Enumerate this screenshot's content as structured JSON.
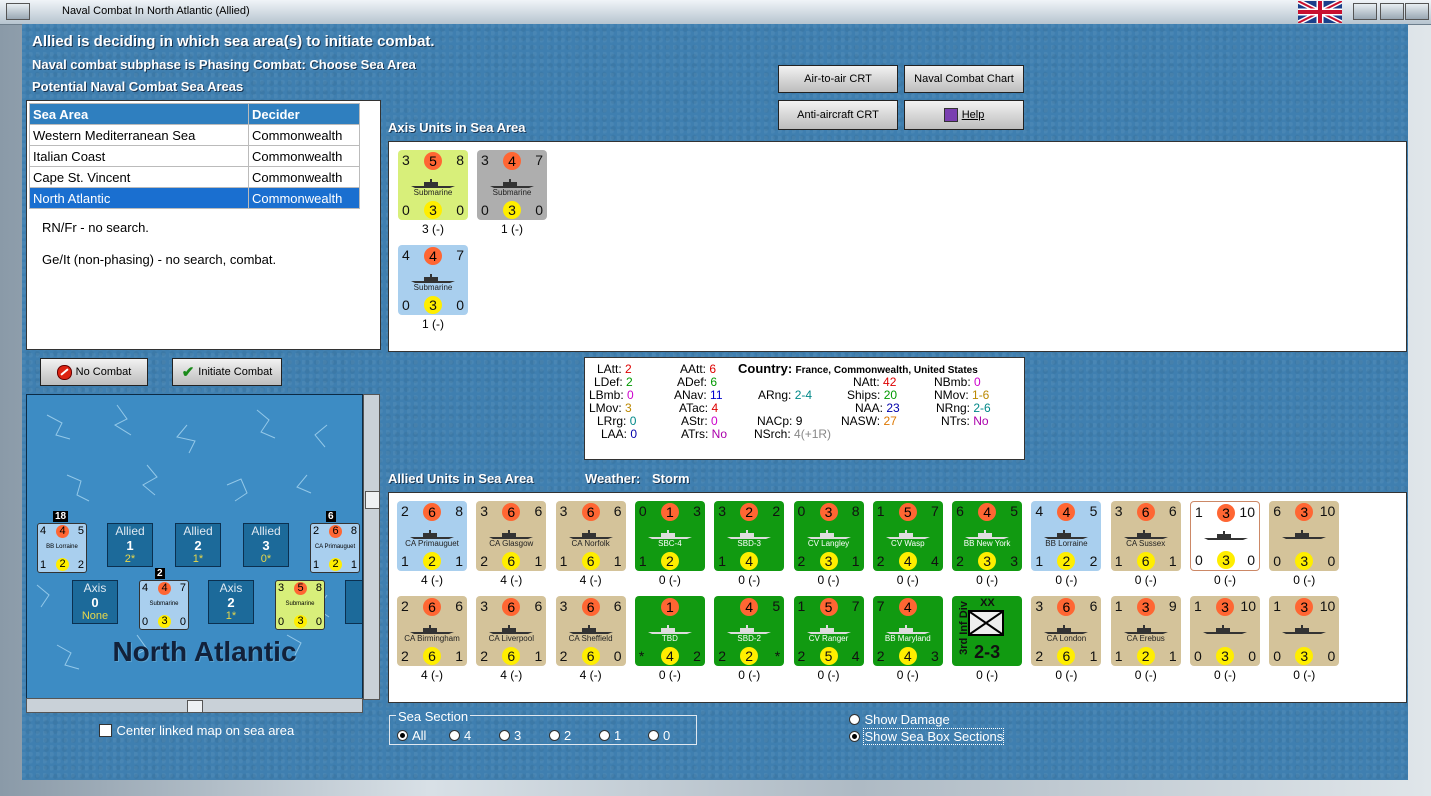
{
  "window": {
    "title": "Naval Combat In North Atlantic (Allied)"
  },
  "header": {
    "line1": "Allied is deciding in which sea area(s) to initiate combat.",
    "line2": "Naval combat subphase is Phasing Combat: Choose Sea Area",
    "line3": "Potential Naval Combat Sea Areas"
  },
  "buttons": {
    "air_to_air": "Air-to-air CRT",
    "naval_chart": "Naval Combat Chart",
    "anti_aircraft": "Anti-aircraft CRT",
    "help": "Help",
    "no_combat": "No Combat",
    "initiate_combat": "Initiate Combat"
  },
  "sea_table": {
    "headers": [
      "Sea Area",
      "Decider"
    ],
    "rows": [
      {
        "area": "Western Mediterranean Sea",
        "decider": "Commonwealth"
      },
      {
        "area": "Italian Coast",
        "decider": "Commonwealth"
      },
      {
        "area": "Cape St. Vincent",
        "decider": "Commonwealth"
      },
      {
        "area": "North Atlantic",
        "decider": "Commonwealth"
      }
    ],
    "note1": "RN/Fr - no search.",
    "note2": "Ge/It (non-phasing) - no search, combat."
  },
  "axis_section": {
    "title": "Axis Units in Sea Area",
    "units": [
      {
        "tl": "3",
        "tc": "5",
        "tr": "8",
        "name": "Submarine",
        "bl": "0",
        "bc": "3",
        "br": "0",
        "count": "3 (-)",
        "color": "#d8ef7a"
      },
      {
        "tl": "3",
        "tc": "4",
        "tr": "7",
        "name": "Submarine",
        "bl": "0",
        "bc": "3",
        "br": "0",
        "count": "1 (-)",
        "color": "#aeaeae"
      },
      {
        "tl": "4",
        "tc": "4",
        "tr": "7",
        "name": "Submarine",
        "bl": "0",
        "bc": "3",
        "br": "0",
        "count": "1 (-)",
        "color": "#a9cfee"
      }
    ]
  },
  "stats": {
    "latt_l": "LAtt:",
    "latt": "2",
    "ldef_l": "LDef:",
    "ldef": "2",
    "lbmb_l": "LBmb:",
    "lbmb": "0",
    "lmov_l": "LMov:",
    "lmov": "3",
    "lrrg_l": "LRrg:",
    "lrrg": "0",
    "laa_l": "LAA:",
    "laa": "0",
    "aatt_l": "AAtt:",
    "aatt": "6",
    "adef_l": "ADef:",
    "adef": "6",
    "anav_l": "ANav:",
    "anav": "11",
    "atac_l": "ATac:",
    "atac": "4",
    "astr_l": "AStr:",
    "astr": "0",
    "atrs_l": "ATrs:",
    "atrs": "No",
    "country_l": "Country:",
    "country": "France, Commonwealth, United States",
    "arng_l": "ARng:",
    "arng": "2-4",
    "nacp_l": "NACp:",
    "nacp": "9",
    "nsrch_l": "NSrch:",
    "nsrch": "4(+1R)",
    "natt_l": "NAtt:",
    "natt": "42",
    "ships_l": "Ships:",
    "ships": "20",
    "naa_l": "NAA:",
    "naa": "23",
    "nasw_l": "NASW:",
    "nasw": "27",
    "nbmb_l": "NBmb:",
    "nbmb": "0",
    "nmov_l": "NMov:",
    "nmov": "1-6",
    "nrng_l": "NRng:",
    "nrng": "2-6",
    "ntrs_l": "NTrs:",
    "ntrs": "No"
  },
  "allied_section": {
    "title": "Allied Units in Sea Area",
    "weather_label": "Weather:",
    "weather": "Storm",
    "row1": [
      {
        "tl": "2",
        "tc": "6",
        "tr": "8",
        "name": "CA Primauguet",
        "bl": "1",
        "bc": "2",
        "br": "1",
        "count": "4 (-)",
        "color": "#a9cfee"
      },
      {
        "tl": "3",
        "tc": "6",
        "tr": "6",
        "name": "CA Glasgow",
        "bl": "2",
        "bc": "6",
        "br": "1",
        "count": "4 (-)",
        "color": "#d4c39a"
      },
      {
        "tl": "3",
        "tc": "6",
        "tr": "6",
        "name": "CA Norfolk",
        "bl": "1",
        "bc": "6",
        "br": "1",
        "count": "4 (-)",
        "color": "#d4c39a"
      },
      {
        "tl": "0",
        "tc": "1",
        "tr": "3",
        "name": "SBC-4",
        "bl": "1",
        "bc": "2",
        "br": "",
        "count": "0 (-)",
        "color": "#119a11"
      },
      {
        "tl": "3",
        "tc": "2",
        "tr": "2",
        "name": "SBD-3",
        "bl": "1",
        "bc": "4",
        "br": "",
        "count": "0 (-)",
        "color": "#119a11"
      },
      {
        "tl": "0",
        "tc": "3",
        "tr": "8",
        "name": "CV Langley",
        "bl": "2",
        "bc": "3",
        "br": "1",
        "count": "0 (-)",
        "color": "#119a11"
      },
      {
        "tl": "1",
        "tc": "5",
        "tr": "7",
        "name": "CV Wasp",
        "bl": "2",
        "bc": "4",
        "br": "4",
        "count": "0 (-)",
        "color": "#119a11"
      },
      {
        "tl": "6",
        "tc": "4",
        "tr": "5",
        "name": "BB New York",
        "bl": "2",
        "bc": "3",
        "br": "3",
        "count": "0 (-)",
        "color": "#119a11"
      },
      {
        "tl": "4",
        "tc": "4",
        "tr": "5",
        "name": "BB Lorraine",
        "bl": "1",
        "bc": "2",
        "br": "2",
        "count": "0 (-)",
        "color": "#a9cfee"
      },
      {
        "tl": "3",
        "tc": "6",
        "tr": "6",
        "name": "CA Sussex",
        "bl": "1",
        "bc": "6",
        "br": "1",
        "count": "0 (-)",
        "color": "#d4c39a"
      },
      {
        "tl": "1",
        "tc": "3",
        "tr": "10",
        "name": "",
        "bl": "0",
        "bc": "3",
        "br": "0",
        "count": "0 (-)",
        "color": "#ffffff"
      },
      {
        "tl": "6",
        "tc": "3",
        "tr": "10",
        "name": "",
        "bl": "0",
        "bc": "3",
        "br": "0",
        "count": "0 (-)",
        "color": "#d4c39a"
      }
    ],
    "row2": [
      {
        "tl": "2",
        "tc": "6",
        "tr": "6",
        "name": "CA Birmingham",
        "bl": "2",
        "bc": "6",
        "br": "1",
        "count": "4 (-)",
        "color": "#d4c39a"
      },
      {
        "tl": "3",
        "tc": "6",
        "tr": "6",
        "name": "CA Liverpool",
        "bl": "2",
        "bc": "6",
        "br": "1",
        "count": "4 (-)",
        "color": "#d4c39a"
      },
      {
        "tl": "3",
        "tc": "6",
        "tr": "6",
        "name": "CA Sheffield",
        "bl": "2",
        "bc": "6",
        "br": "0",
        "count": "4 (-)",
        "color": "#d4c39a"
      },
      {
        "tl": "",
        "tc": "1",
        "tr": "",
        "name": "TBD",
        "bl": "*",
        "bc": "4",
        "br": "2",
        "count": "0 (-)",
        "color": "#119a11"
      },
      {
        "tl": "",
        "tc": "4",
        "tr": "5",
        "name": "SBD-2",
        "bl": "2",
        "bc": "2",
        "br": "*",
        "count": "0 (-)",
        "color": "#119a11"
      },
      {
        "tl": "1",
        "tc": "5",
        "tr": "7",
        "name": "CV Ranger",
        "bl": "2",
        "bc": "5",
        "br": "4",
        "count": "0 (-)",
        "color": "#119a11"
      },
      {
        "tl": "7",
        "tc": "4",
        "tr": "",
        "name": "BB Maryland",
        "bl": "2",
        "bc": "4",
        "br": "3",
        "count": "0 (-)",
        "color": "#119a11"
      },
      {
        "tl": "",
        "tc": "",
        "tr": "",
        "name": "3rd Inf Div",
        "bl": "",
        "bc": "",
        "br": "",
        "count": "0 (-)",
        "color": "#119a11",
        "inf": "2-3",
        "xx": "XX"
      },
      {
        "tl": "3",
        "tc": "6",
        "tr": "6",
        "name": "CA London",
        "bl": "2",
        "bc": "6",
        "br": "1",
        "count": "0 (-)",
        "color": "#d4c39a"
      },
      {
        "tl": "1",
        "tc": "3",
        "tr": "9",
        "name": "CA Erebus",
        "bl": "1",
        "bc": "2",
        "br": "1",
        "count": "0 (-)",
        "color": "#d4c39a"
      },
      {
        "tl": "1",
        "tc": "3",
        "tr": "10",
        "name": "",
        "bl": "0",
        "bc": "3",
        "br": "0",
        "count": "0 (-)",
        "color": "#d4c39a"
      },
      {
        "tl": "1",
        "tc": "3",
        "tr": "10",
        "name": "",
        "bl": "0",
        "bc": "3",
        "br": "0",
        "count": "0 (-)",
        "color": "#d4c39a"
      }
    ]
  },
  "map": {
    "area_name": "North Atlantic",
    "allied_boxes": [
      {
        "label": "Allied",
        "num": "1",
        "val": "2*"
      },
      {
        "label": "Allied",
        "num": "2",
        "val": "1*"
      },
      {
        "label": "Allied",
        "num": "3",
        "val": "0*"
      }
    ],
    "axis_boxes": [
      {
        "label": "Axis",
        "num": "0",
        "val": "None"
      },
      {
        "label": "Axis",
        "num": "2",
        "val": "1*"
      }
    ],
    "axis_partial": "A",
    "stack_left": {
      "count": "18",
      "tl": "4",
      "tc": "4",
      "tr": "5",
      "name": "BB Lorraine",
      "bl": "1",
      "bc": "2",
      "br": "2"
    },
    "stack_right": {
      "count": "6",
      "tl": "2",
      "tc": "6",
      "tr": "8",
      "name": "CA Primauguet",
      "bl": "1",
      "bc": "2",
      "br": "1"
    },
    "stack_axis1": {
      "count": "2",
      "tl": "4",
      "tc": "4",
      "tr": "7",
      "name": "Submarine",
      "bl": "0",
      "bc": "3",
      "br": "0"
    },
    "stack_axis2": {
      "tl": "3",
      "tc": "5",
      "tr": "8",
      "name": "Submarine",
      "bl": "0",
      "bc": "3",
      "br": "0"
    }
  },
  "footer": {
    "center_map": "Center linked map on sea area",
    "sea_section": "Sea Section",
    "options": [
      "All",
      "4",
      "3",
      "2",
      "1",
      "0"
    ],
    "selected_option": "All",
    "show_damage": "Show Damage",
    "show_sections": "Show Sea Box Sections"
  },
  "colors": {
    "panel": "#3f7fb0",
    "selected_row": "#1a6fd0",
    "header_row": "#2f7fbf",
    "strength_circle": "#ff6633",
    "move_circle": "#ffee00"
  }
}
